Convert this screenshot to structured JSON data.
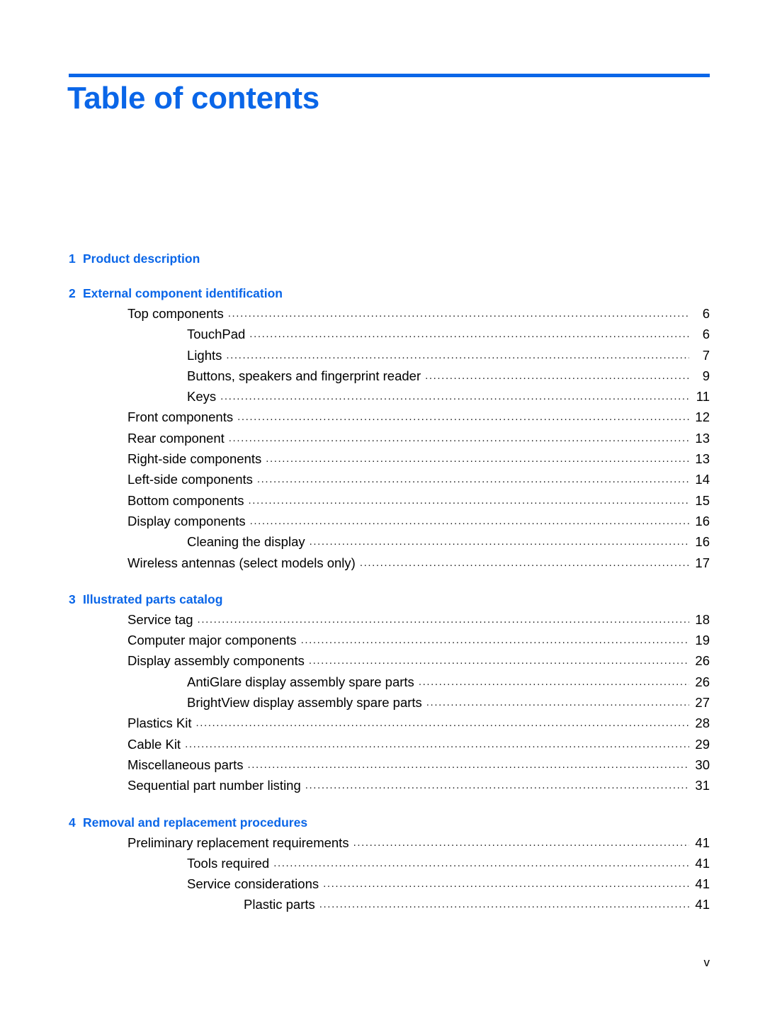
{
  "document": {
    "title": "Table of contents",
    "accent_color": "#0a66e8",
    "text_color": "#000000",
    "leader_char": "."
  },
  "footer": {
    "page_label": "v"
  },
  "chapters": [
    {
      "number": "1",
      "title": "Product description",
      "entries": []
    },
    {
      "number": "2",
      "title": "External component identification",
      "entries": [
        {
          "level": 1,
          "label": "Top components",
          "page": "6"
        },
        {
          "level": 2,
          "label": "TouchPad",
          "page": "6"
        },
        {
          "level": 2,
          "label": "Lights",
          "page": "7"
        },
        {
          "level": 2,
          "label": "Buttons, speakers and fingerprint reader",
          "page": "9"
        },
        {
          "level": 2,
          "label": "Keys",
          "page": "11"
        },
        {
          "level": 1,
          "label": "Front components",
          "page": "12"
        },
        {
          "level": 1,
          "label": "Rear component",
          "page": "13"
        },
        {
          "level": 1,
          "label": "Right-side components",
          "page": "13"
        },
        {
          "level": 1,
          "label": "Left-side components",
          "page": "14"
        },
        {
          "level": 1,
          "label": "Bottom components",
          "page": "15"
        },
        {
          "level": 1,
          "label": "Display components",
          "page": "16"
        },
        {
          "level": 2,
          "label": "Cleaning the display",
          "page": "16"
        },
        {
          "level": 1,
          "label": "Wireless antennas (select models only)",
          "page": "17"
        }
      ]
    },
    {
      "number": "3",
      "title": "Illustrated parts catalog",
      "entries": [
        {
          "level": 1,
          "label": "Service tag",
          "page": "18"
        },
        {
          "level": 1,
          "label": "Computer major components",
          "page": "19"
        },
        {
          "level": 1,
          "label": "Display assembly components",
          "page": "26"
        },
        {
          "level": 2,
          "label": "AntiGlare display assembly spare parts",
          "page": "26"
        },
        {
          "level": 2,
          "label": "BrightView display assembly spare parts",
          "page": "27"
        },
        {
          "level": 1,
          "label": "Plastics Kit",
          "page": "28"
        },
        {
          "level": 1,
          "label": "Cable Kit",
          "page": "29"
        },
        {
          "level": 1,
          "label": "Miscellaneous parts",
          "page": "30"
        },
        {
          "level": 1,
          "label": "Sequential part number listing",
          "page": "31"
        }
      ]
    },
    {
      "number": "4",
      "title": "Removal and replacement procedures",
      "entries": [
        {
          "level": 1,
          "label": "Preliminary replacement requirements",
          "page": "41"
        },
        {
          "level": 2,
          "label": "Tools required",
          "page": "41"
        },
        {
          "level": 2,
          "label": "Service considerations",
          "page": "41"
        },
        {
          "level": 3,
          "label": "Plastic parts",
          "page": "41"
        }
      ]
    }
  ]
}
